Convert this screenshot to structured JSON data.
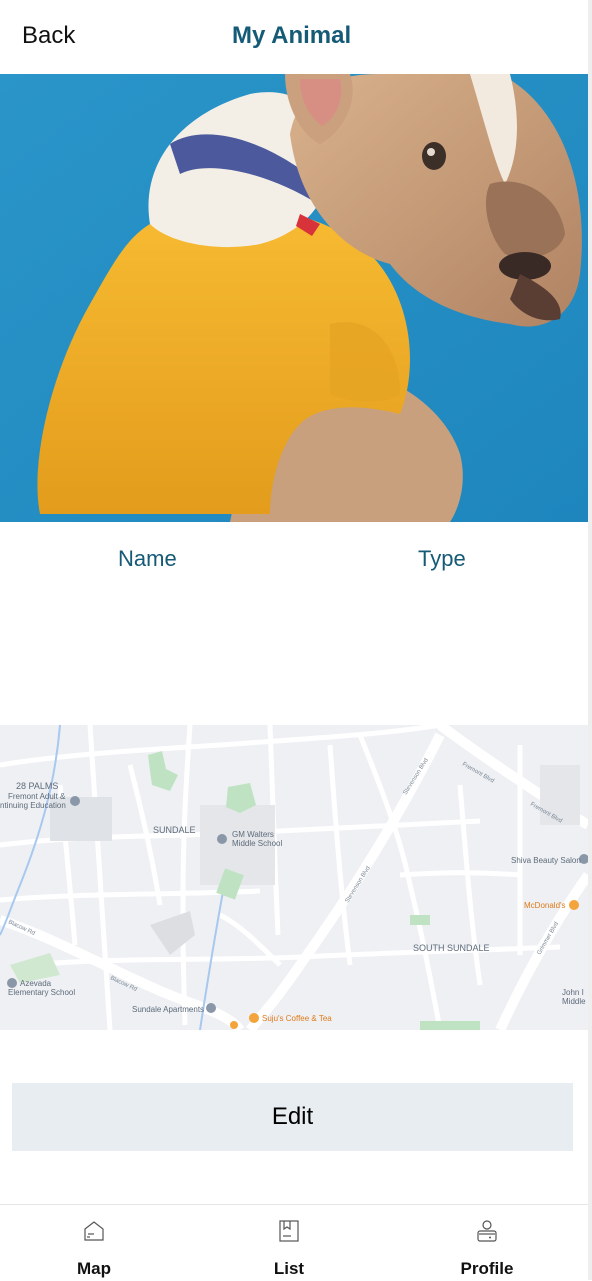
{
  "header": {
    "back_label": "Back",
    "title": "My Animal"
  },
  "animal": {
    "name_label": "Name",
    "type_label": "Type"
  },
  "map": {
    "labels": {
      "sundale": "SUNDALE",
      "south_sundale": "SOUTH SUNDALE",
      "gm_walters_1": "GM Walters",
      "gm_walters_2": "Middle School",
      "fremont_adult_1": "Fremont Adult &",
      "fremont_adult_2": "ntinuing Education",
      "shiva": "Shiva Beauty Salon",
      "mcdonalds": "McDonald's",
      "azevada_1": "Azevada",
      "azevada_2": "Elementary School",
      "sundale_apts": "Sundale Apartments",
      "sujus": "Suju's Coffee & Tea",
      "palms": "28 PALMS",
      "john_1": "John I",
      "john_2": "Middle",
      "fremont_blvd": "Fremont Blvd",
      "fremont_blvd_2": "Fremont Blvd",
      "stevenson_blvd": "Stevenson Blvd",
      "stevenson_blvd_2": "Stevenson Blvd",
      "blacow_rd": "Blacow Rd",
      "blacow_rd_2": "Blacow Rd",
      "grimmer_blvd": "Grimmer Blvd"
    }
  },
  "actions": {
    "edit_label": "Edit"
  },
  "tabs": [
    {
      "label": "Map",
      "icon": "map-icon"
    },
    {
      "label": "List",
      "icon": "list-icon"
    },
    {
      "label": "Profile",
      "icon": "profile-icon"
    }
  ],
  "colors": {
    "accent": "#155a76",
    "photo_bg": "#1f8fc4",
    "sweater": "#f2b02c",
    "button_bg": "#e8edf1"
  }
}
